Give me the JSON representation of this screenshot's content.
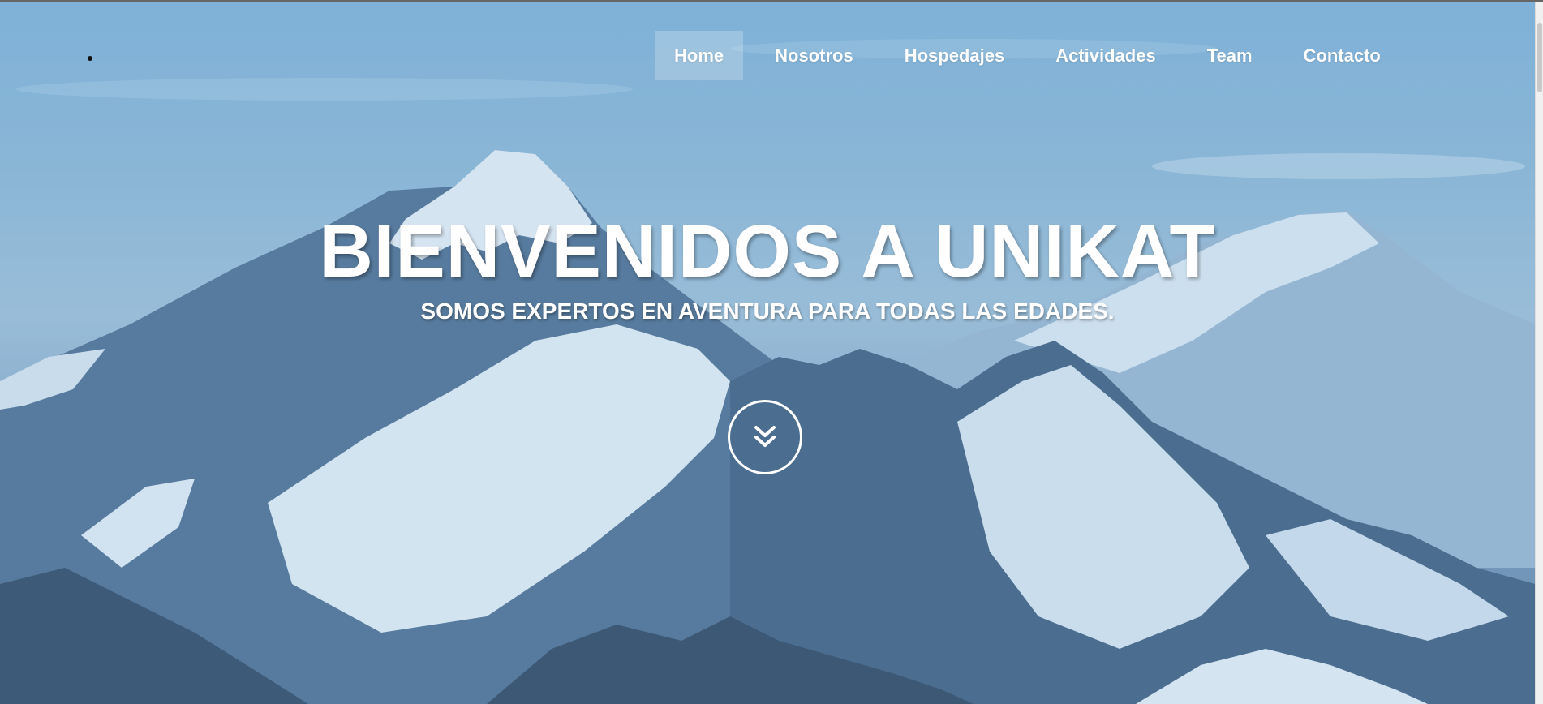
{
  "header": {
    "logo_icon": "dot-icon"
  },
  "nav": {
    "items": [
      {
        "label": "Home",
        "active": true
      },
      {
        "label": "Nosotros",
        "active": false
      },
      {
        "label": "Hospedajes",
        "active": false
      },
      {
        "label": "Actividades",
        "active": false
      },
      {
        "label": "Team",
        "active": false
      },
      {
        "label": "Contacto",
        "active": false
      }
    ]
  },
  "hero": {
    "title": "BIENVENIDOS A UNIKAT",
    "subtitle": "SOMOS EXPERTOS EN AVENTURA PARA TODAS LAS EDADES.",
    "scroll_icon": "double-chevron-down-icon",
    "background": "snowy-mountain-range-photo"
  },
  "colors": {
    "text": "#ffffff",
    "sky": "#8ab6d6",
    "snow": "#e4eef6",
    "rock": "#3f5e80"
  }
}
